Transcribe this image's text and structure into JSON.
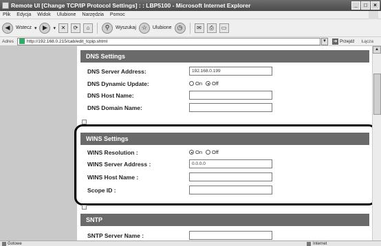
{
  "window": {
    "title": "Remote UI [Change TCP/IP Protocol Settings] : : LBP5100 - Microsoft Internet Explorer",
    "buttons": [
      "_",
      "□",
      "×"
    ]
  },
  "menu": {
    "items": [
      "Plik",
      "Edycja",
      "Widok",
      "Ulubione",
      "Narzędzia",
      "Pomoc"
    ]
  },
  "toolbar": {
    "back_label": "Wstecz",
    "search_label": "Wyszukaj",
    "favorites_label": "Ulubione"
  },
  "address": {
    "label": "Adres",
    "url": "http://192.168.0.215/cab/edit_tcpip.shtml",
    "go_label": "Przejdź",
    "links_label": "Łącza"
  },
  "dns": {
    "header": "DNS Settings",
    "server_address_label": "DNS Server Address:",
    "server_address_value": "192.168.0.199",
    "dynamic_update_label": "DNS Dynamic Update:",
    "dynamic_update_on": "On",
    "dynamic_update_off": "Off",
    "dynamic_update_selected": "Off",
    "host_name_label": "DNS Host Name:",
    "host_name_value": "",
    "domain_name_label": "DNS Domain Name:",
    "domain_name_value": ""
  },
  "wins": {
    "header": "WINS Settings",
    "resolution_label": "WINS Resolution :",
    "resolution_on": "On",
    "resolution_off": "Off",
    "resolution_selected": "On",
    "server_address_label": "WINS Server Address :",
    "server_address_value": "0.0.0.0",
    "host_name_label": "WINS Host Name :",
    "host_name_value": "",
    "scope_id_label": "Scope ID :",
    "scope_id_value": ""
  },
  "sntp": {
    "header": "SNTP",
    "server_name_label": "SNTP Server Name :",
    "server_name_value": ""
  },
  "status": {
    "left_text": "Gotowe",
    "zone_text": "Internet"
  }
}
